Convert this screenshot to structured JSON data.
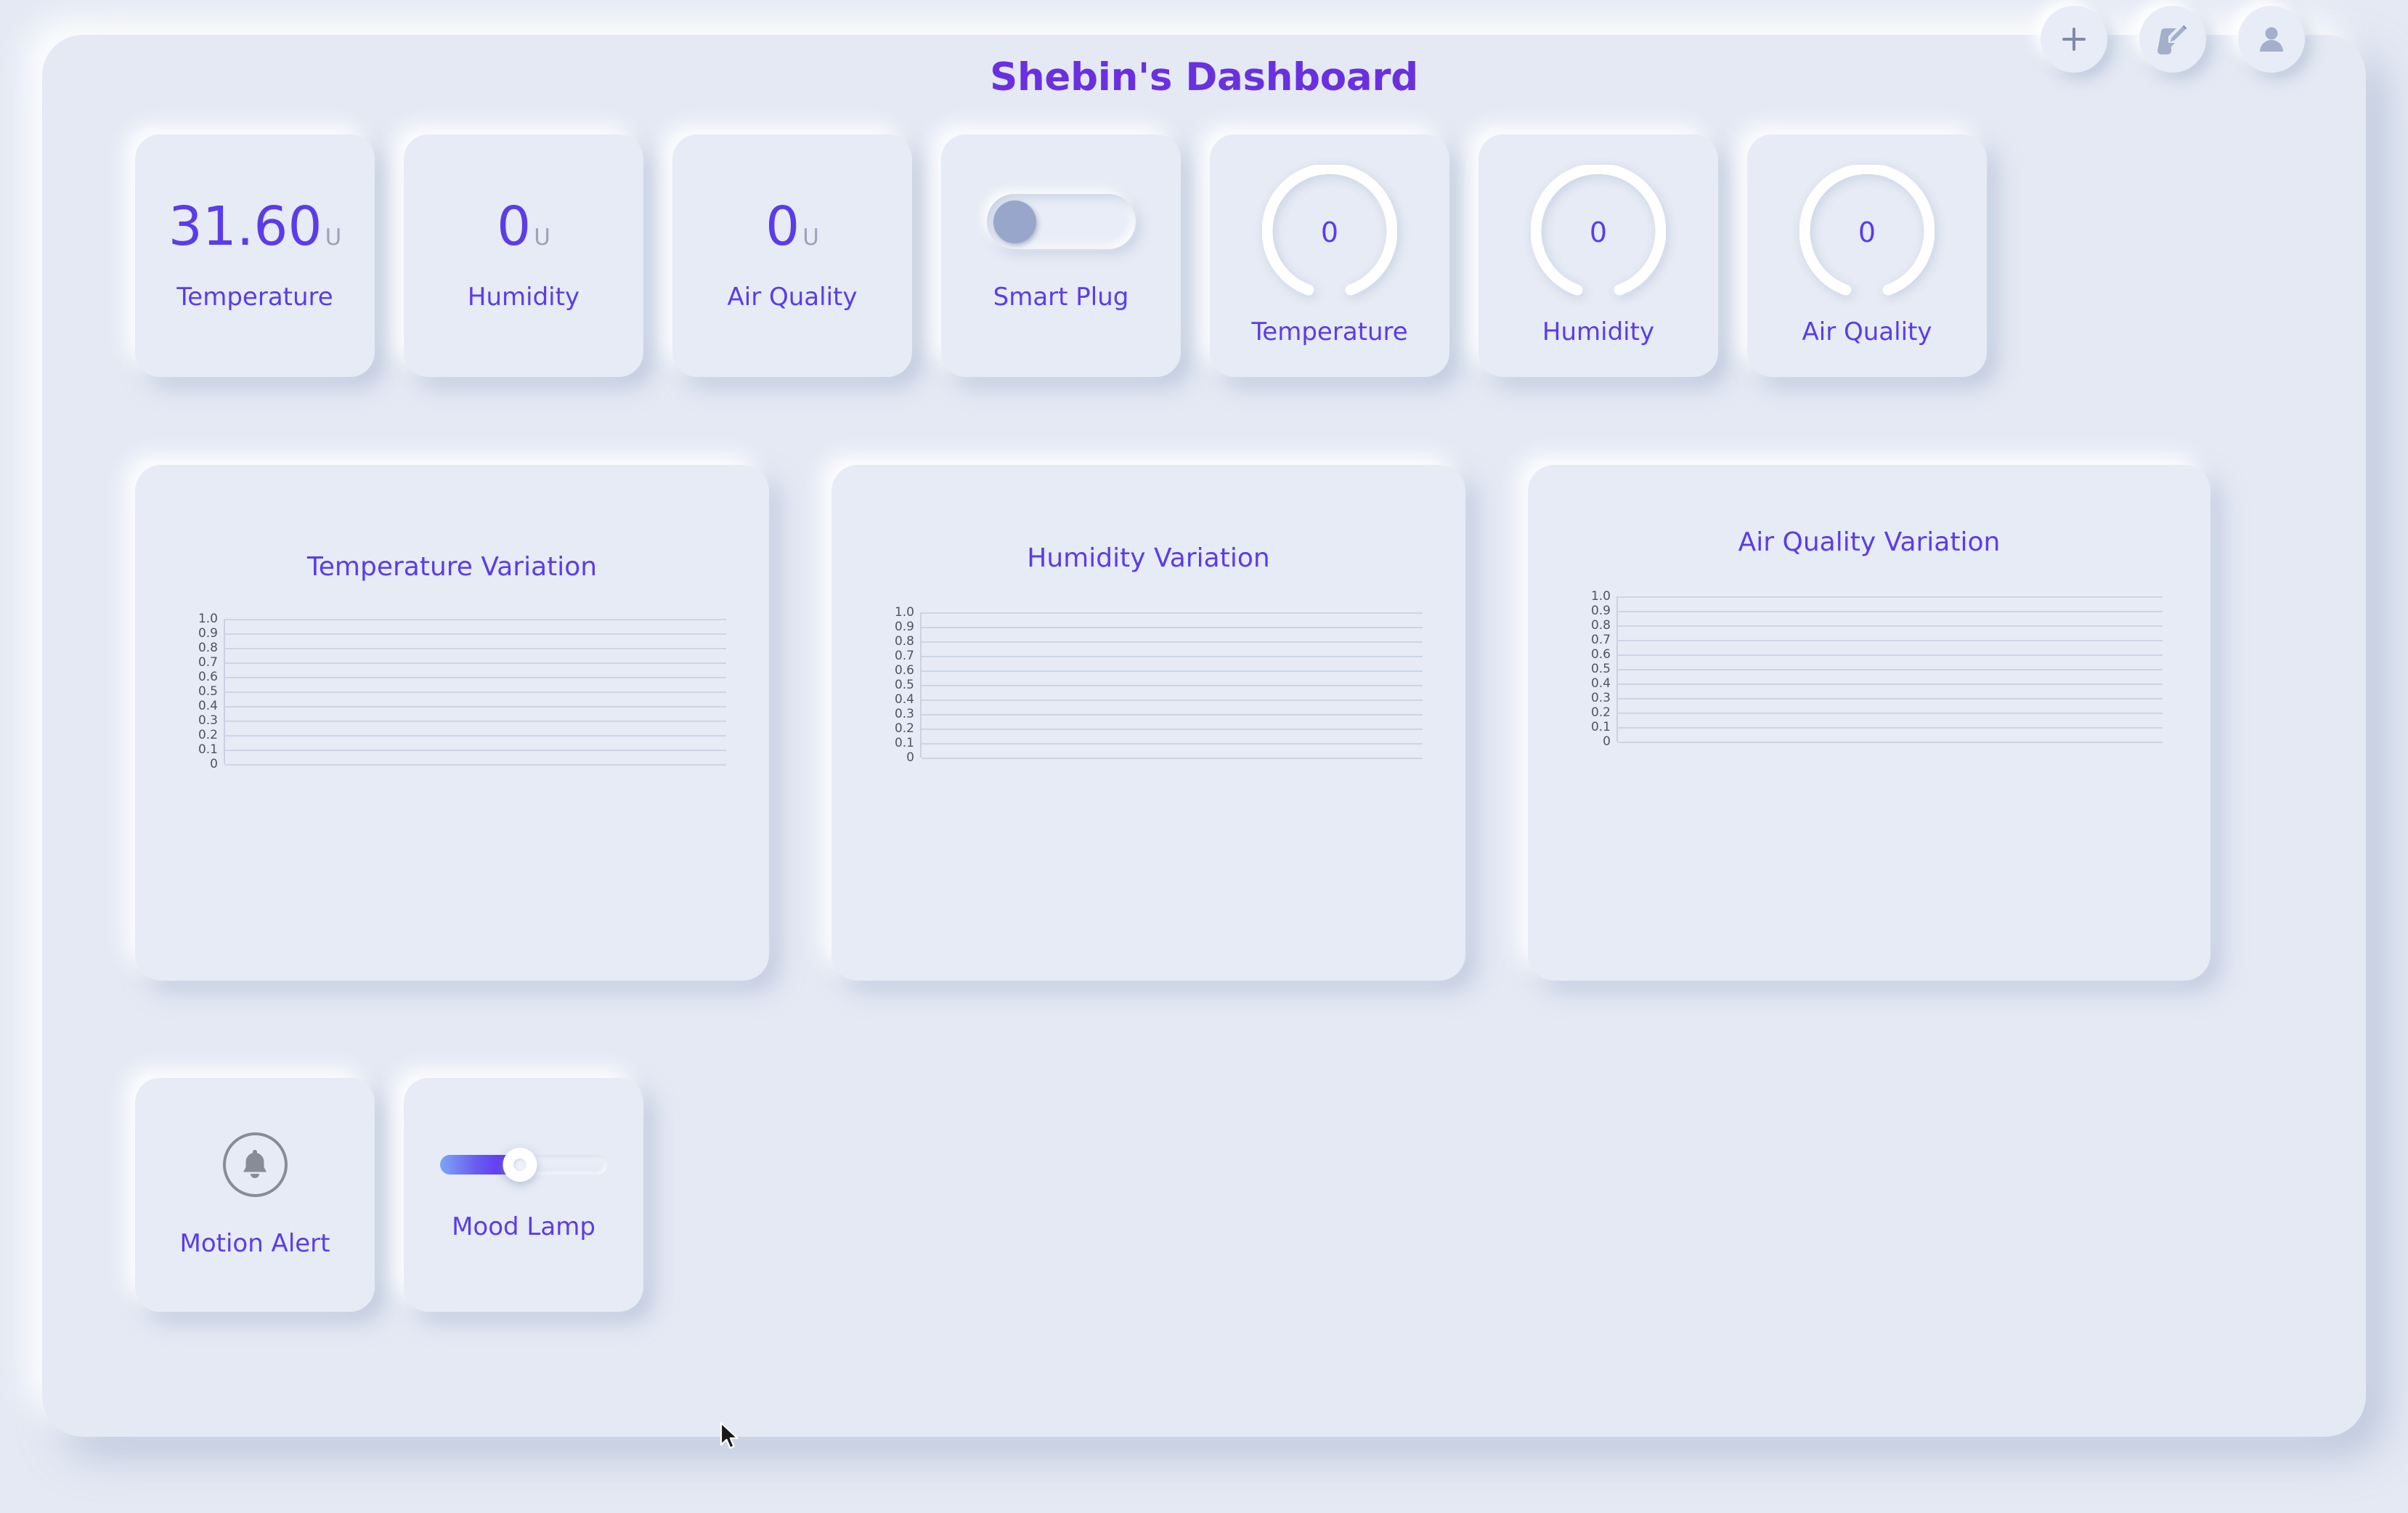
{
  "header": {
    "title": "Shebin's Dashboard",
    "actions": [
      {
        "name": "add-widget-button",
        "icon": "plus-icon"
      },
      {
        "name": "edit-dashboard-button",
        "icon": "edit-pencil-icon"
      },
      {
        "name": "user-profile-button",
        "icon": "user-icon"
      }
    ]
  },
  "colors": {
    "background": "#e4e9f4",
    "card": "#e6ebf5",
    "accent": "#5b3ce8",
    "title": "#6a30e0",
    "unit_text": "#9aa4bb",
    "gauge_ring": "#ffffff",
    "toggle_knob": "#98a6cb",
    "slider_fill_start": "#7da6f5",
    "slider_fill_end": "#5a23f0",
    "grid": "#cdd5e4",
    "tick_text": "#4f5560",
    "bell_icon": "#878d98"
  },
  "devices": [
    {
      "type": "stat",
      "value": "31.60",
      "unit": "U",
      "label": "Temperature"
    },
    {
      "type": "stat",
      "value": "0",
      "unit": "U",
      "label": "Humidity"
    },
    {
      "type": "stat",
      "value": "0",
      "unit": "U",
      "label": "Air Quality"
    },
    {
      "type": "toggle",
      "label": "Smart Plug",
      "state": "off"
    },
    {
      "type": "gauge",
      "value": "0",
      "label": "Temperature",
      "percent": 0
    },
    {
      "type": "gauge",
      "value": "0",
      "label": "Humidity",
      "percent": 0
    },
    {
      "type": "gauge",
      "value": "0",
      "label": "Air Quality",
      "percent": 0
    }
  ],
  "controls": [
    {
      "type": "alert",
      "label": "Motion Alert",
      "icon": "bell-icon"
    },
    {
      "type": "slider",
      "label": "Mood Lamp",
      "percent": 48
    }
  ],
  "chart_data": [
    {
      "type": "line",
      "title": "Temperature Variation",
      "xlabel": "",
      "ylabel": "",
      "ylim": [
        0,
        1.0
      ],
      "yticks": [
        "1.0",
        "0.9",
        "0.8",
        "0.7",
        "0.6",
        "0.5",
        "0.4",
        "0.3",
        "0.2",
        "0.1",
        "0"
      ],
      "grid": true,
      "legend": "none",
      "series": [
        {
          "name": "Temperature",
          "x": [],
          "values": []
        }
      ]
    },
    {
      "type": "line",
      "title": "Humidity Variation",
      "xlabel": "",
      "ylabel": "",
      "ylim": [
        0,
        1.0
      ],
      "yticks": [
        "1.0",
        "0.9",
        "0.8",
        "0.7",
        "0.6",
        "0.5",
        "0.4",
        "0.3",
        "0.2",
        "0.1",
        "0"
      ],
      "grid": true,
      "legend": "none",
      "series": [
        {
          "name": "Humidity",
          "x": [],
          "values": []
        }
      ]
    },
    {
      "type": "line",
      "title": "Air Quality Variation",
      "xlabel": "",
      "ylabel": "",
      "ylim": [
        0,
        1.0
      ],
      "yticks": [
        "1.0",
        "0.9",
        "0.8",
        "0.7",
        "0.6",
        "0.5",
        "0.4",
        "0.3",
        "0.2",
        "0.1",
        "0"
      ],
      "grid": true,
      "legend": "none",
      "series": [
        {
          "name": "Air Quality",
          "x": [],
          "values": []
        }
      ]
    }
  ]
}
